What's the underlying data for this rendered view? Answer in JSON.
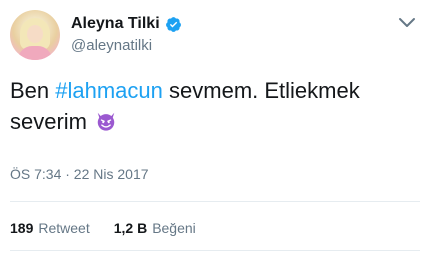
{
  "author": {
    "display_name": "Aleyna Tilki",
    "handle": "@aleynatilki"
  },
  "tweet": {
    "text_before": "Ben ",
    "hashtag": "#lahmacun",
    "text_after": " sevmem. Etliekmek severim",
    "emoji": "smiling-devil-icon",
    "timestamp": "ÖS 7:34 · 22 Nis 2017"
  },
  "stats": {
    "retweets_count": "189",
    "retweets_label": "Retweet",
    "likes_count": "1,2 B",
    "likes_label": "Beğeni"
  },
  "colors": {
    "link": "#1da1f2",
    "text_primary": "#14171a",
    "text_secondary": "#657786",
    "divider": "#e6ecf0",
    "emoji": "#9b59d0"
  },
  "icons": {
    "verified": "verified-badge-icon",
    "menu": "chevron-down-icon"
  }
}
